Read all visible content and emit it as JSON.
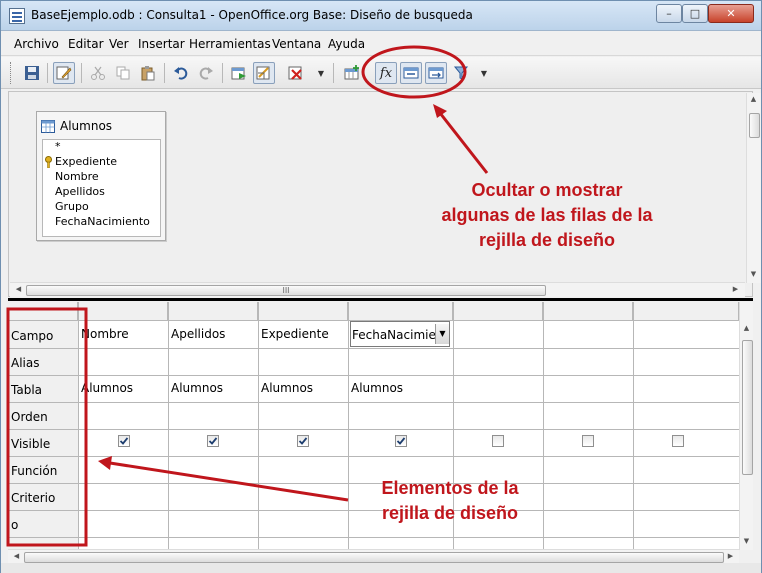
{
  "window": {
    "title": "BaseEjemplo.odb : Consulta1 - OpenOffice.org Base: Diseño de busqueda",
    "controls": {
      "minimize": "–",
      "maximize": "□",
      "close": "✕"
    }
  },
  "menu": [
    "Archivo",
    "Editar",
    "Ver",
    "Insertar",
    "Herramientas",
    "Ventana",
    "Ayuda"
  ],
  "toolbar": {
    "buttons": [
      "save-icon",
      "edit-mode-icon",
      "cut-icon",
      "copy-icon",
      "paste-icon",
      "undo-icon",
      "redo-icon",
      "run-query-icon",
      "design-view-icon",
      "clear-query-icon",
      "add-table-icon",
      "functions-icon",
      "table-name-icon",
      "alias-icon",
      "distinct-values-icon"
    ],
    "functions_label": "fx"
  },
  "table_box": {
    "title": "Alumnos",
    "fields": [
      "*",
      "Expediente",
      "Nombre",
      "Apellidos",
      "Grupo",
      "FechaNacimiento"
    ],
    "primary_key_field": "Expediente"
  },
  "grid": {
    "row_labels": [
      "Campo",
      "Alias",
      "Tabla",
      "Orden",
      "Visible",
      "Función",
      "Criterio",
      "o"
    ],
    "columns": [
      {
        "campo": "Nombre",
        "tabla": "Alumnos",
        "visible": true
      },
      {
        "campo": "Apellidos",
        "tabla": "Alumnos",
        "visible": true
      },
      {
        "campo": "Expediente",
        "tabla": "Alumnos",
        "visible": true
      },
      {
        "campo": "FechaNacimient",
        "tabla": "Alumnos",
        "visible": true
      },
      {
        "campo": "",
        "tabla": "",
        "visible": false
      },
      {
        "campo": "",
        "tabla": "",
        "visible": false
      },
      {
        "campo": "",
        "tabla": "",
        "visible": false
      }
    ]
  },
  "scrollbars": {
    "thumb_grip": "III"
  },
  "annotations": {
    "top": [
      "Ocultar o mostrar",
      "algunas de las  filas de la",
      "rejilla de diseño"
    ],
    "bottom": [
      "Elementos de la",
      "rejilla de diseño"
    ],
    "color": "#c0161c"
  }
}
